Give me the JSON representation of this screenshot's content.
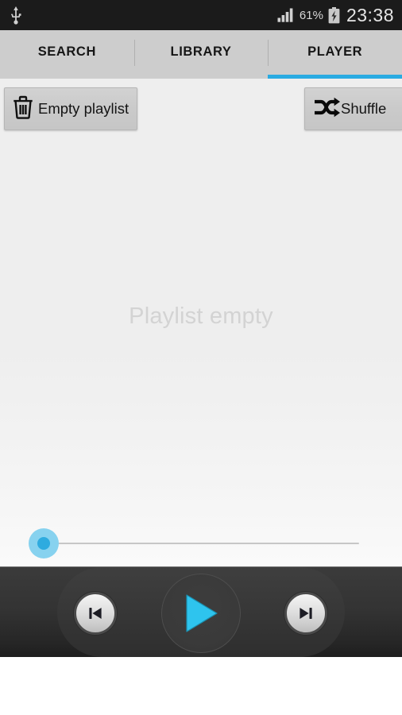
{
  "status_bar": {
    "usb_icon": "usb-icon",
    "signal_icon": "signal-bars-icon",
    "battery_percent": "61%",
    "battery_icon": "battery-charging-icon",
    "clock": "23:38",
    "background_color": "#1b1b1b",
    "text_color": "#e6e6e6"
  },
  "tabs": {
    "items": [
      {
        "label": "SEARCH",
        "active": false
      },
      {
        "label": "LIBRARY",
        "active": false
      },
      {
        "label": "PLAYER",
        "active": true
      }
    ],
    "active_index": 2,
    "indicator_color": "#2aabe2",
    "bar_color": "#cdcdcd"
  },
  "toolbar": {
    "empty_playlist_label": "Empty playlist",
    "empty_playlist_icon": "trash-icon",
    "shuffle_label": "Shuffle",
    "shuffle_icon": "shuffle-icon"
  },
  "playlist": {
    "empty_message": "Playlist empty",
    "empty_message_color": "#d3d3d3",
    "item_count": 0
  },
  "seek_bar": {
    "position_percent": 0,
    "thumb_color": "#2eabdf",
    "thumb_halo_color": "#87d2ef",
    "track_color": "#c7c7c7"
  },
  "transport": {
    "previous_label": "Previous track",
    "previous_icon": "skip-previous-icon",
    "play_label": "Play",
    "play_icon": "play-icon",
    "play_icon_color": "#2ec4ee",
    "next_label": "Next track",
    "next_icon": "skip-next-icon",
    "background_color": "#333333"
  }
}
